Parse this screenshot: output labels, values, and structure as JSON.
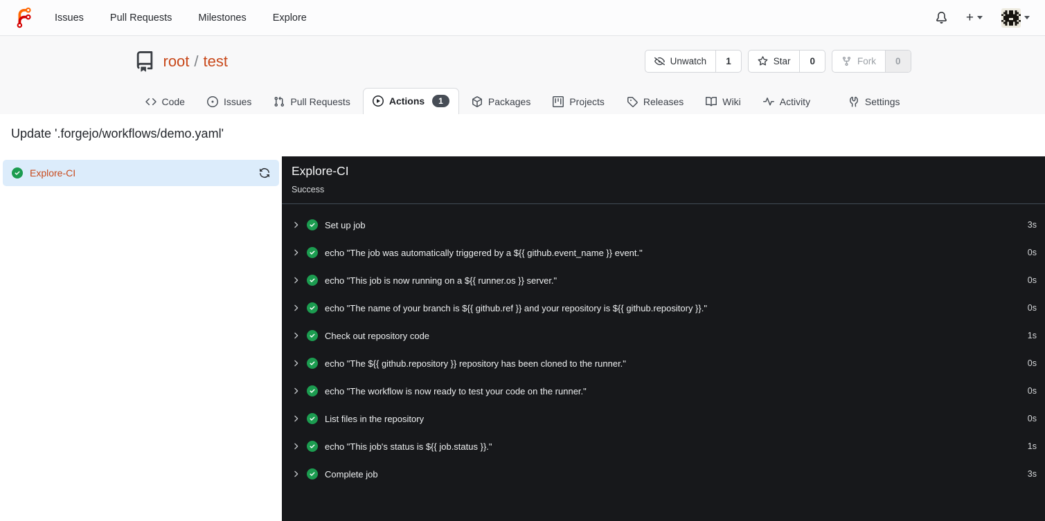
{
  "colors": {
    "accent_orange": "#c8481a",
    "logo_orange": "#ff6600",
    "logo_red": "#d40000",
    "success_green": "#1c9c50",
    "run_panel_bg": "#17181b",
    "selected_job_bg": "#dcecfb",
    "actions_badge_bg": "#474d56"
  },
  "navbar": {
    "items": [
      "Issues",
      "Pull Requests",
      "Milestones",
      "Explore"
    ]
  },
  "repo_header": {
    "owner": "root",
    "separator": "/",
    "name": "test",
    "actions": [
      {
        "label": "Unwatch",
        "count": "1",
        "icon": "eye-closed-icon"
      },
      {
        "label": "Star",
        "count": "0",
        "icon": "star-icon"
      },
      {
        "label": "Fork",
        "count": "0",
        "icon": "fork-icon",
        "disabled": true
      }
    ]
  },
  "repo_tabs": [
    {
      "label": "Code",
      "icon": "code-icon"
    },
    {
      "label": "Issues",
      "icon": "issue-opened-icon"
    },
    {
      "label": "Pull Requests",
      "icon": "git-pull-request-icon"
    },
    {
      "label": "Actions",
      "icon": "play-icon",
      "badge": "1",
      "active": true
    },
    {
      "label": "Packages",
      "icon": "package-icon"
    },
    {
      "label": "Projects",
      "icon": "project-icon"
    },
    {
      "label": "Releases",
      "icon": "tag-icon"
    },
    {
      "label": "Wiki",
      "icon": "book-icon"
    },
    {
      "label": "Activity",
      "icon": "pulse-icon"
    },
    {
      "label": "Settings",
      "icon": "tools-icon"
    }
  ],
  "page": {
    "title": "Update '.forgejo/workflows/demo.yaml'"
  },
  "sidebar": {
    "job": {
      "name": "Explore-CI",
      "status": "success"
    }
  },
  "run_panel": {
    "title": "Explore-CI",
    "status": "Success",
    "steps": [
      {
        "name": "Set up job",
        "duration": "3s"
      },
      {
        "name": "echo \"The job was automatically triggered by a ${{ github.event_name }} event.\"",
        "duration": "0s"
      },
      {
        "name": "echo \"This job is now running on a ${{ runner.os }} server.\"",
        "duration": "0s"
      },
      {
        "name": "echo \"The name of your branch is ${{ github.ref }} and your repository is ${{ github.repository }}.\"",
        "duration": "0s"
      },
      {
        "name": "Check out repository code",
        "duration": "1s"
      },
      {
        "name": "echo \"The ${{ github.repository }} repository has been cloned to the runner.\"",
        "duration": "0s"
      },
      {
        "name": "echo \"The workflow is now ready to test your code on the runner.\"",
        "duration": "0s"
      },
      {
        "name": "List files in the repository",
        "duration": "0s"
      },
      {
        "name": "echo \"This job's status is ${{ job.status }}.\"",
        "duration": "1s"
      },
      {
        "name": "Complete job",
        "duration": "3s"
      }
    ]
  }
}
